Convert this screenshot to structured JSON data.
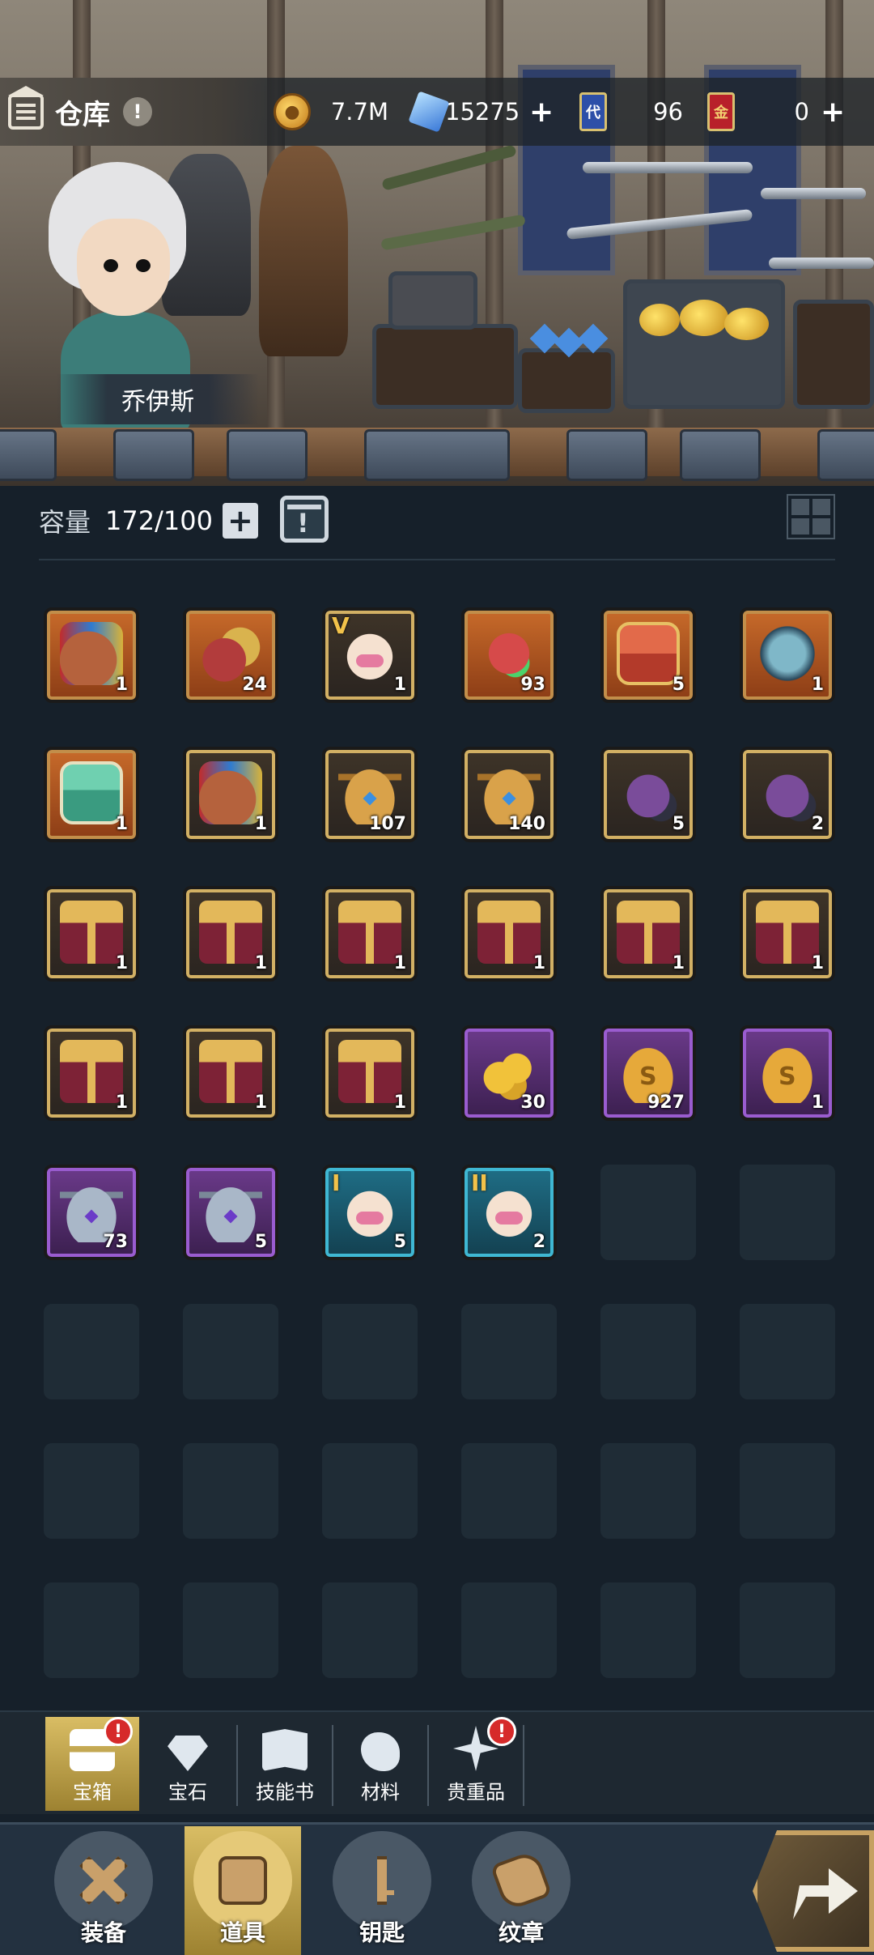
{
  "header": {
    "title": "仓库",
    "info_icon": "info-icon",
    "resources": [
      {
        "name": "gold-coin",
        "value": "7.7M",
        "icon": "coin-icon",
        "icon_text": "",
        "addable": false
      },
      {
        "name": "diamond",
        "value": "15275",
        "icon": "gem-icon",
        "icon_text": "",
        "addable": true
      },
      {
        "name": "blue-card",
        "value": "96",
        "icon": "card-icon",
        "icon_text": "代",
        "addable": false
      },
      {
        "name": "red-card",
        "value": "0",
        "icon": "card-icon",
        "icon_text": "金",
        "addable": true
      }
    ],
    "plus_symbol": "+"
  },
  "hero": {
    "name": "乔伊斯"
  },
  "capacity": {
    "label": "容量",
    "value": "172/100",
    "plus": "+"
  },
  "items": [
    [
      {
        "pic": "sack",
        "rarity": "orange",
        "count": "1",
        "tag": ""
      },
      {
        "pic": "ore",
        "rarity": "orange",
        "count": "24",
        "tag": ""
      },
      {
        "pic": "pod",
        "rarity": "gold",
        "count": "1",
        "tag": "V"
      },
      {
        "pic": "gem-heart",
        "rarity": "orange",
        "count": "93",
        "tag": ""
      },
      {
        "pic": "redchest",
        "rarity": "orange",
        "count": "5",
        "tag": ""
      },
      {
        "pic": "dragon",
        "rarity": "orange",
        "count": "1",
        "tag": ""
      }
    ],
    [
      {
        "pic": "greenchest",
        "rarity": "orange",
        "count": "1",
        "tag": ""
      },
      {
        "pic": "sack",
        "rarity": "gold",
        "count": "1",
        "tag": ""
      },
      {
        "pic": "urn",
        "rarity": "gold",
        "count": "107",
        "tag": ""
      },
      {
        "pic": "urn",
        "rarity": "gold",
        "count": "140",
        "tag": ""
      },
      {
        "pic": "cat",
        "rarity": "gold",
        "count": "5",
        "tag": ""
      },
      {
        "pic": "cat",
        "rarity": "gold",
        "count": "2",
        "tag": ""
      }
    ],
    [
      {
        "pic": "giftbox",
        "rarity": "gold",
        "count": "1",
        "tag": ""
      },
      {
        "pic": "giftbox",
        "rarity": "gold",
        "count": "1",
        "tag": ""
      },
      {
        "pic": "giftbox",
        "rarity": "gold",
        "count": "1",
        "tag": ""
      },
      {
        "pic": "giftbox",
        "rarity": "gold",
        "count": "1",
        "tag": ""
      },
      {
        "pic": "giftbox",
        "rarity": "gold",
        "count": "1",
        "tag": ""
      },
      {
        "pic": "giftbox",
        "rarity": "gold",
        "count": "1",
        "tag": ""
      }
    ],
    [
      {
        "pic": "giftbox",
        "rarity": "gold",
        "count": "1",
        "tag": ""
      },
      {
        "pic": "giftbox",
        "rarity": "gold",
        "count": "1",
        "tag": ""
      },
      {
        "pic": "giftbox",
        "rarity": "gold",
        "count": "1",
        "tag": ""
      },
      {
        "pic": "coins",
        "rarity": "purple",
        "count": "30",
        "tag": ""
      },
      {
        "pic": "moneybag",
        "rarity": "purple",
        "count": "927",
        "tag": ""
      },
      {
        "pic": "moneybag",
        "rarity": "purple",
        "count": "1",
        "tag": ""
      }
    ],
    [
      {
        "pic": "silverurn",
        "rarity": "purple",
        "count": "73",
        "tag": ""
      },
      {
        "pic": "silverurn",
        "rarity": "purple",
        "count": "5",
        "tag": ""
      },
      {
        "pic": "pod",
        "rarity": "blue",
        "count": "5",
        "tag": "I"
      },
      {
        "pic": "pod",
        "rarity": "blue",
        "count": "2",
        "tag": "II"
      },
      null,
      null
    ],
    [
      null,
      null,
      null,
      null,
      null,
      null
    ],
    [
      null,
      null,
      null,
      null,
      null,
      null
    ],
    [
      null,
      null,
      null,
      null,
      null,
      null
    ]
  ],
  "categories": [
    {
      "label": "宝箱",
      "icon": "chest-icon",
      "active": true,
      "badge": "!"
    },
    {
      "label": "宝石",
      "icon": "gem-icon",
      "active": false,
      "badge": ""
    },
    {
      "label": "技能书",
      "icon": "book-icon",
      "active": false,
      "badge": ""
    },
    {
      "label": "材料",
      "icon": "material-icon",
      "active": false,
      "badge": ""
    },
    {
      "label": "贵重品",
      "icon": "valuable-icon",
      "active": false,
      "badge": "!"
    }
  ],
  "nav": [
    {
      "label": "装备",
      "icon": "equipment-icon",
      "active": false
    },
    {
      "label": "道具",
      "icon": "item-icon",
      "active": true
    },
    {
      "label": "钥匙",
      "icon": "key-icon",
      "active": false
    },
    {
      "label": "纹章",
      "icon": "emblem-icon",
      "active": false
    }
  ],
  "goto_button": {
    "icon": "arrow-icon"
  },
  "colors": {
    "rarity_orange": "#c76a2a",
    "rarity_gold": "#d2b064",
    "rarity_purple": "#9a5ccf",
    "rarity_blue": "#3fb7d2",
    "active_tab": "#d9bd64",
    "badge_red": "#d62a2a"
  }
}
